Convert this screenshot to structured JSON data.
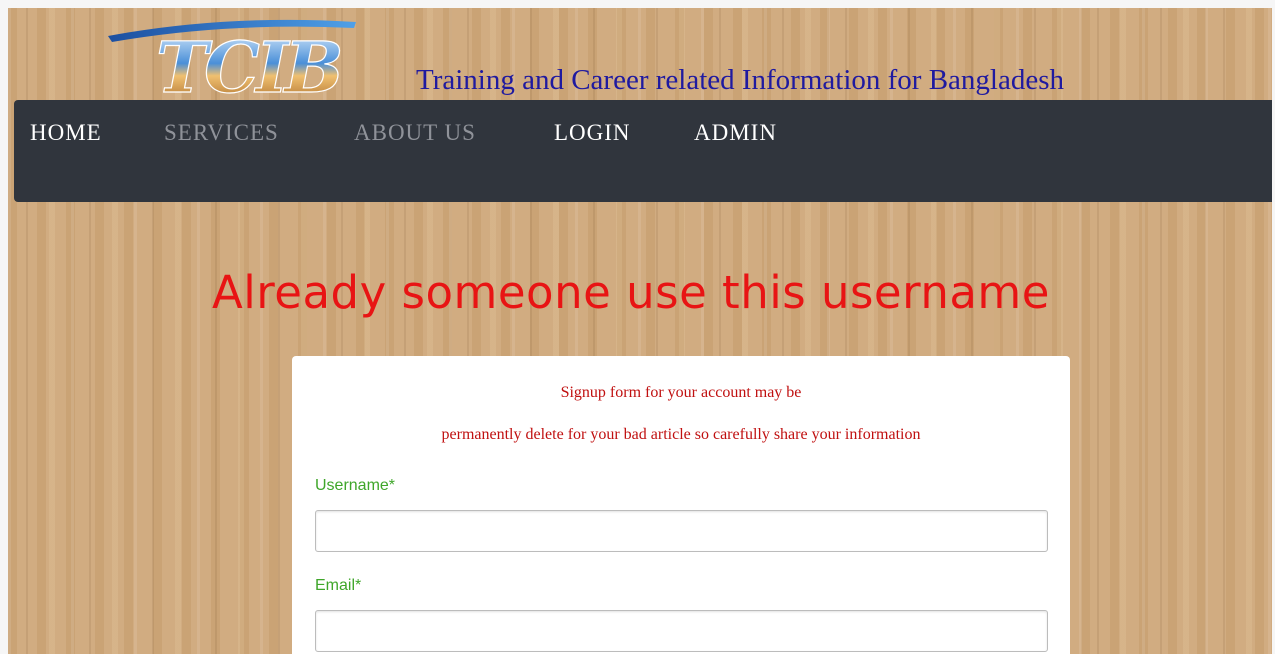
{
  "brand": {
    "logo_text": "TCIB",
    "tagline": "Training and Career related Information for Bangladesh"
  },
  "nav": {
    "items": [
      {
        "label": "HOME"
      },
      {
        "label": "SERVICES"
      },
      {
        "label": "ABOUT US"
      },
      {
        "label": "LOGIN"
      },
      {
        "label": "ADMIN"
      }
    ]
  },
  "alert": {
    "message": "Already someone use this username"
  },
  "form": {
    "notice_line1": "Signup form for your account may be",
    "notice_line2": "permanently delete for your bad article so carefully share your information",
    "fields": [
      {
        "label": "Username*",
        "value": ""
      },
      {
        "label": "Email*",
        "value": ""
      }
    ]
  },
  "colors": {
    "tagline": "#1f1aa0",
    "navbar": "#30353d",
    "alert": "#e81414",
    "label": "#3fa62a",
    "notice": "#c01010"
  }
}
